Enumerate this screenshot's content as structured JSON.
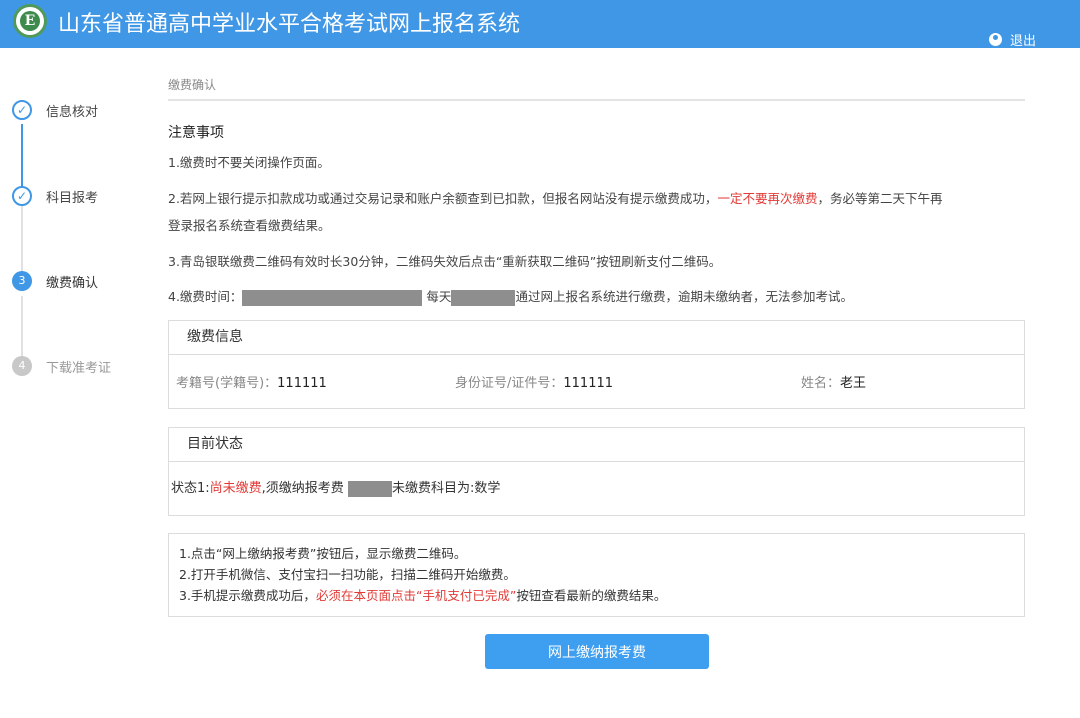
{
  "header": {
    "logo_letter": "E",
    "title": "山东省普通高中学业水平合格考试网上报名系统",
    "logout_label": "退出"
  },
  "steps": [
    {
      "marker": "✓",
      "label": "信息核对",
      "state": "done"
    },
    {
      "marker": "✓",
      "label": "科目报考",
      "state": "done"
    },
    {
      "marker": "3",
      "label": "缴费确认",
      "state": "active"
    },
    {
      "marker": "4",
      "label": "下载准考证",
      "state": "todo"
    }
  ],
  "breadcrumb": "缴费确认",
  "notice": {
    "title": "注意事项",
    "item1": "1.缴费时不要关闭操作页面。",
    "item2_before": "2.若网上银行提示扣款成功或通过交易记录和账户余额查到已扣款，但报名网站没有提示缴费成功，",
    "item2_red": "一定不要再次缴费",
    "item2_after": "，务必等第二天下午再",
    "item2_line2": "登录报名系统查看缴费结果。",
    "item3": "3.青岛银联缴费二维码有效时长30分钟，二维码失效后点击“重新获取二维码”按钮刷新支付二维码。",
    "item4_prefix": "4.缴费时间：",
    "item4_mid": "每天",
    "item4_suffix": "通过网上报名系统进行缴费，逾期未缴纳者，无法参加考试。"
  },
  "payment_info": {
    "title": "缴费信息",
    "exam_no_label": "考籍号(学籍号)：",
    "exam_no_value": "111111",
    "id_label": "身份证号/证件号：",
    "id_value": "111111",
    "name_label": "姓名：",
    "name_value": "老王"
  },
  "current_status": {
    "title": "目前状态",
    "prefix": "状态1:",
    "status_red": "尚未缴费",
    "mid": ",须缴纳报考费",
    "suffix": "未缴费科目为:数学"
  },
  "guide": {
    "line1": "1.点击“网上缴纳报考费”按钮后，显示缴费二维码。",
    "line2": "2.打开手机微信、支付宝扫一扫功能，扫描二维码开始缴费。",
    "line3_before": "3.手机提示缴费成功后，",
    "line3_red": "必须在本页面点击“手机支付已完成”",
    "line3_after": "按钮查看最新的缴费结果。"
  },
  "pay_button_label": "网上缴纳报考费",
  "colors": {
    "header_bg": "#3f97e5",
    "accent": "#3f97e5",
    "warning_red": "#e23a36",
    "redaction_gray": "#8e8e8e"
  }
}
